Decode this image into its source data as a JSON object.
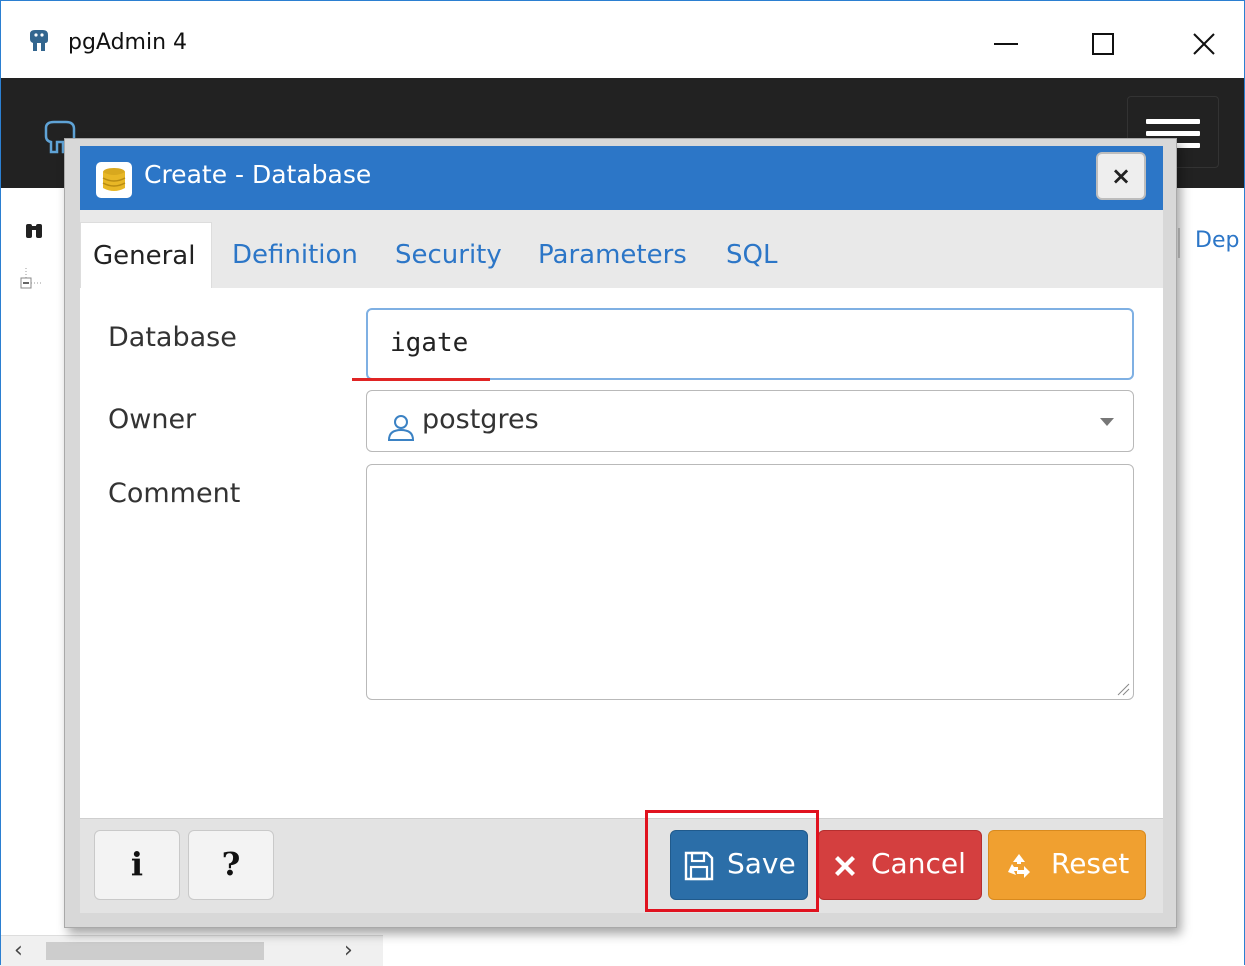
{
  "window": {
    "title": "pgAdmin 4",
    "controls": [
      "minimize",
      "maximize",
      "close"
    ]
  },
  "background": {
    "right_tab_partial": "Dep"
  },
  "dialog": {
    "title": "Create - Database",
    "close_label": "×",
    "tabs": [
      {
        "label": "General",
        "active": true
      },
      {
        "label": "Definition",
        "active": false
      },
      {
        "label": "Security",
        "active": false
      },
      {
        "label": "Parameters",
        "active": false
      },
      {
        "label": "SQL",
        "active": false
      }
    ],
    "fields": {
      "database": {
        "label": "Database",
        "value": "igate"
      },
      "owner": {
        "label": "Owner",
        "value": "postgres"
      },
      "comment": {
        "label": "Comment",
        "value": ""
      }
    },
    "footer": {
      "info_label": "i",
      "help_label": "?",
      "save_label": "Save",
      "cancel_label": "Cancel",
      "reset_label": "Reset"
    }
  },
  "colors": {
    "dialog_header": "#2c76c7",
    "save": "#2b6ea8",
    "cancel": "#d43f3f",
    "reset": "#f0a030",
    "highlight": "#e0121f"
  }
}
